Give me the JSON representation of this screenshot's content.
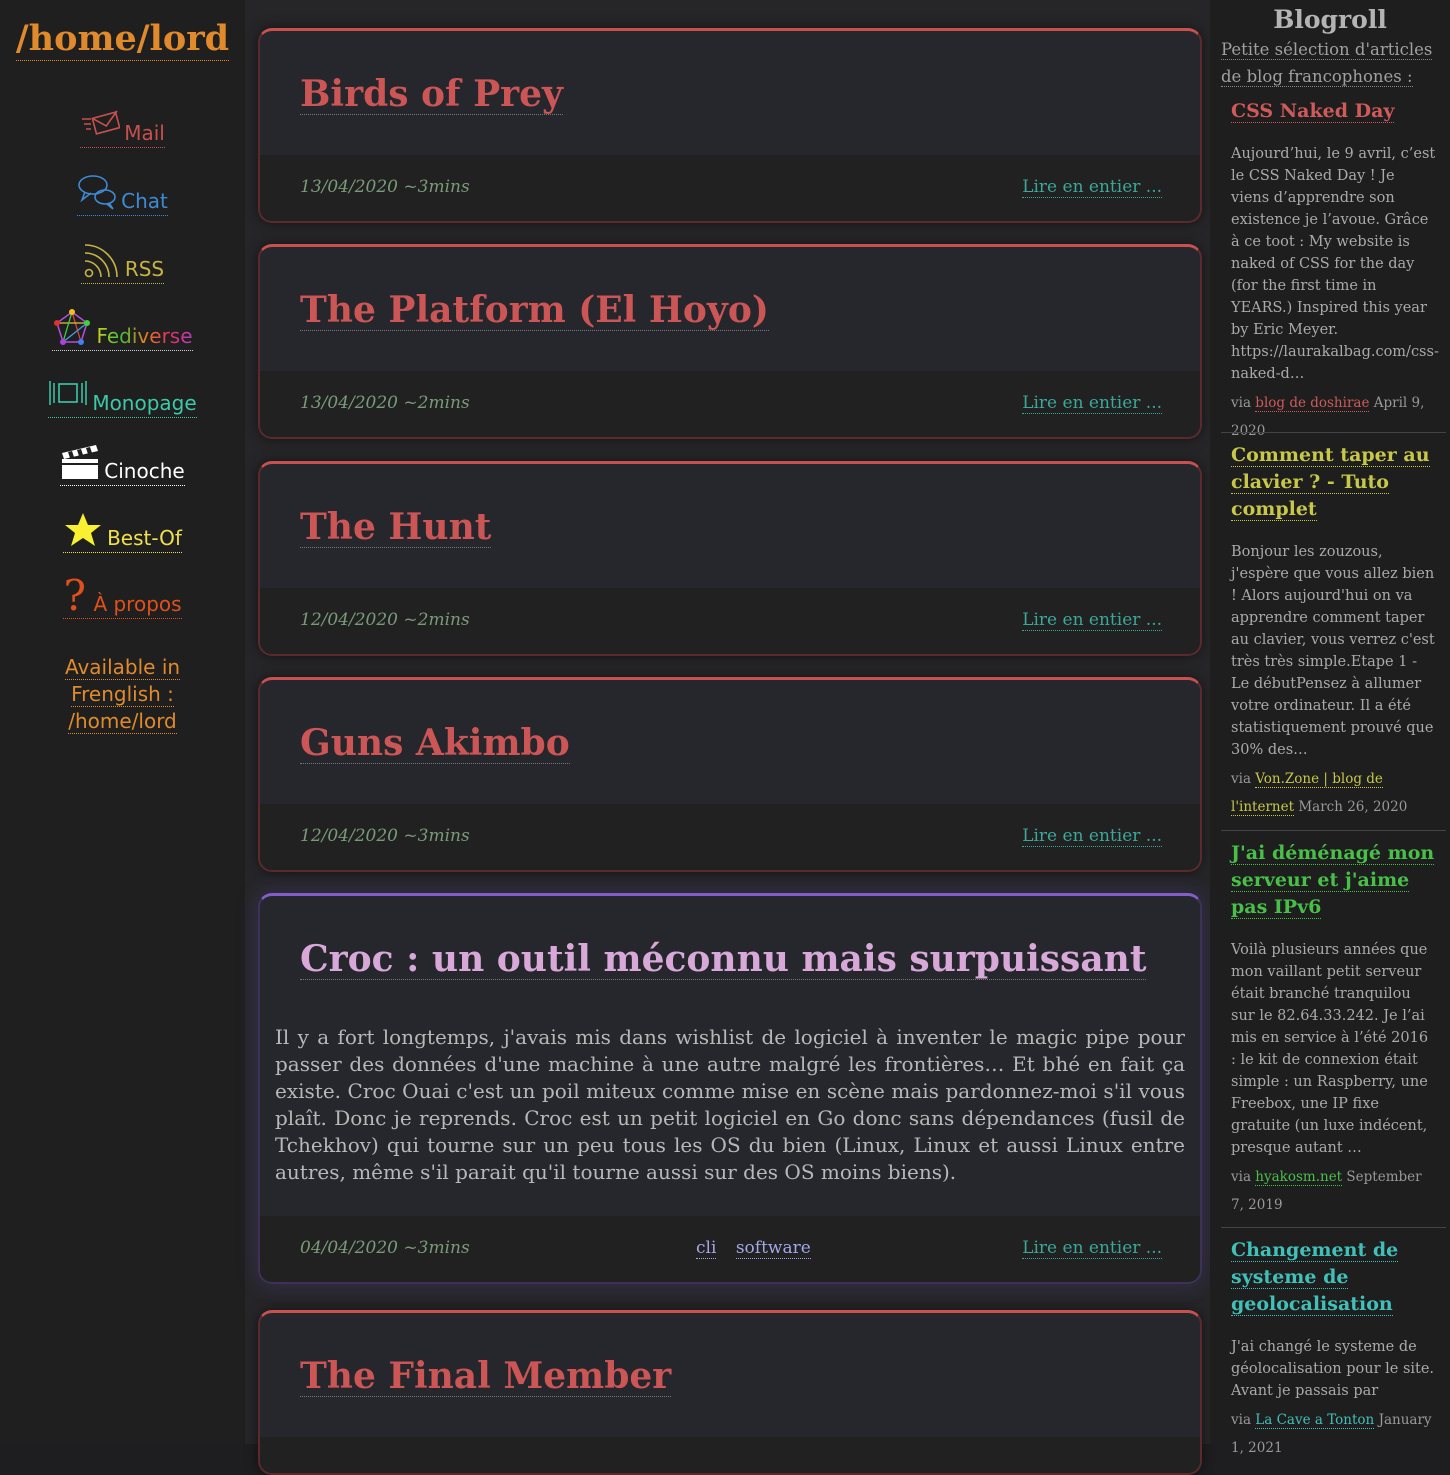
{
  "site": {
    "title": "/home/lord"
  },
  "nav": [
    {
      "label": "Mail",
      "icon": "mail-icon",
      "color": "#c8504f"
    },
    {
      "label": "Chat",
      "icon": "chat-icon",
      "color": "#3d8bd6"
    },
    {
      "label": "RSS",
      "icon": "rss-icon",
      "color": "#c8b440"
    },
    {
      "label": "Fediverse",
      "icon": "fediverse-icon",
      "color": "#d0d0d0"
    },
    {
      "label": "Monopage",
      "icon": "monopage-icon",
      "color": "#3dc8a8"
    },
    {
      "label": "Cinoche",
      "icon": "clapperboard-icon",
      "color": "#ffffff"
    },
    {
      "label": "Best-Of",
      "icon": "star-icon",
      "color": "#f0e050"
    },
    {
      "label": "À propos",
      "icon": "question-icon",
      "color": "#e0501c"
    }
  ],
  "frenglish": {
    "lines": [
      "Available in",
      "Frenglish :",
      "/home/lord"
    ]
  },
  "posts": [
    {
      "title": "Birds of Prey",
      "meta": "13/04/2020 ~3mins",
      "more": "Lire en entier ..."
    },
    {
      "title": "The Platform (El Hoyo)",
      "meta": "13/04/2020 ~2mins",
      "more": "Lire en entier ..."
    },
    {
      "title": "The Hunt",
      "meta": "12/04/2020 ~2mins",
      "more": "Lire en entier ..."
    },
    {
      "title": "Guns Akimbo",
      "meta": "12/04/2020 ~3mins",
      "more": "Lire en entier ..."
    },
    {
      "title": "Croc : un outil méconnu mais surpuissant",
      "excerpt": "Il y a fort longtemps, j'avais mis dans wishlist de logiciel à inventer le magic pipe pour passer des données d'une machine à une autre malgré les frontières… Et bhé en fait ça existe. Croc Ouai c'est un poil miteux comme mise en scène mais pardonnez-moi s'il vous plaît. Donc je reprends. Croc est un petit logiciel en Go donc sans dépendances (fusil de Tchekhov) qui tourne sur un peu tous les OS du bien (Linux, Linux et aussi Linux entre autres, même s'il parait qu'il tourne aussi sur des OS moins biens).",
      "meta": "04/04/2020 ~3mins",
      "tags": [
        "cli",
        "software"
      ],
      "more": "Lire en entier ..."
    },
    {
      "title": "The Final Member"
    }
  ],
  "blogroll": {
    "title": "Blogroll",
    "subtitle": "Petite sélection d'articles de blog francophones :",
    "feeds": [
      {
        "title": "CSS Naked Day",
        "color": "#d05a5a",
        "text": "Aujourd’hui, le 9 avril, c’est le CSS Naked Day ! Je viens d’apprendre son existence je l’avoue. Grâce à ce toot : My website is naked of CSS for the day (for the first time in YEARS.) Inspired this year by Eric Meyer. https://laurakalbag.com/css-naked-d…",
        "via": "via",
        "source": "blog de doshirae",
        "date": "April 9, 2020"
      },
      {
        "title": "Comment taper au clavier ? - Tuto complet",
        "color": "#c8c848",
        "text": "Bonjour les zouzous, j'espère que vous allez bien ! Alors aujourd'hui on va apprendre comment taper au clavier, vous verrez c'est très très simple.Etape 1 - Le débutPensez à allumer votre ordinateur. Il a été statistiquement prouvé que 30% des…",
        "via": "via",
        "source": "Von.Zone | blog de l'internet",
        "date": "March 26, 2020"
      },
      {
        "title": "J'ai déménagé mon serveur et j'aime pas IPv6",
        "color": "#48c048",
        "text": "Voilà plusieurs années que mon vaillant petit serveur était branché tranquilou sur le 82.64.33.242. Je l’ai mis en service à l’été 2016 : le kit de connexion était simple : un Raspberry, une Freebox, une IP fixe gratuite (un luxe indécent, presque autant …",
        "via": "via",
        "source": "hyakosm.net",
        "date": "September 7, 2019"
      },
      {
        "title": "Changement de systeme de geolocalisation",
        "color": "#40c0b8",
        "text": "J'ai changé le systeme de géolocalisation pour le site. Avant je passais par",
        "via": "via",
        "source": "La Cave a Tonton",
        "date": "January 1, 2021"
      }
    ]
  }
}
